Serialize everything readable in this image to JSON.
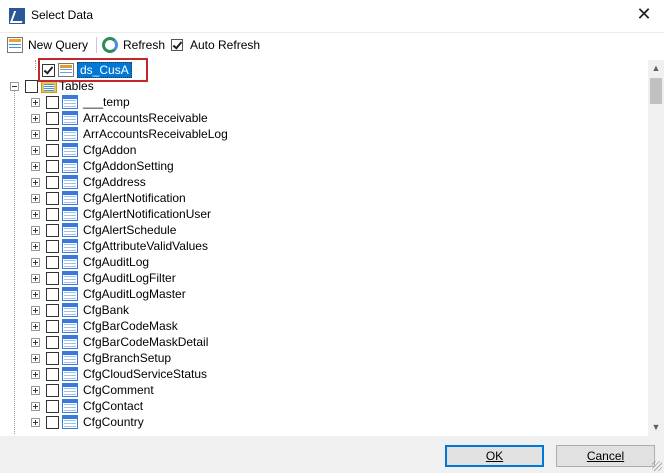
{
  "window": {
    "title": "Select Data"
  },
  "toolbar": {
    "new_query_label": "New Query",
    "refresh_label": "Refresh",
    "auto_refresh_label": "Auto Refresh",
    "auto_refresh_checked": true
  },
  "tree": {
    "datasource": {
      "label": "ds_CusA",
      "checked": true
    },
    "tables_folder": {
      "label": "Tables",
      "checked": false
    },
    "tables": [
      "___temp",
      "ArrAccountsReceivable",
      "ArrAccountsReceivableLog",
      "CfgAddon",
      "CfgAddonSetting",
      "CfgAddress",
      "CfgAlertNotification",
      "CfgAlertNotificationUser",
      "CfgAlertSchedule",
      "CfgAttributeValidValues",
      "CfgAuditLog",
      "CfgAuditLogFilter",
      "CfgAuditLogMaster",
      "CfgBank",
      "CfgBarCodeMask",
      "CfgBarCodeMaskDetail",
      "CfgBranchSetup",
      "CfgCloudServiceStatus",
      "CfgComment",
      "CfgContact",
      "CfgCountry"
    ]
  },
  "buttons": {
    "ok_label": "OK",
    "cancel_label": "Cancel"
  },
  "colors": {
    "selection": "#0078d7",
    "highlight_box": "#c0282d",
    "table_icon": "#3a7bd5"
  }
}
